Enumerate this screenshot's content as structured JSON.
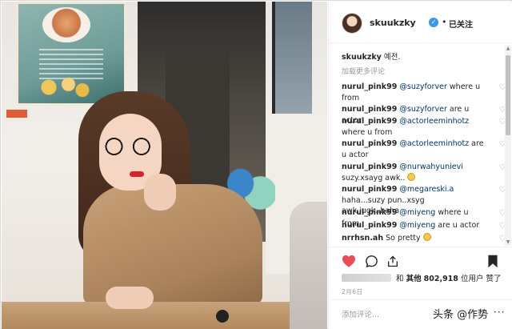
{
  "post": {
    "username": "skuukzky",
    "follow_label": "已关注",
    "separator": "•",
    "verified_mark": "✓",
    "caption_user": "skuukzky",
    "caption_text": "예전.",
    "load_more": "加载更多评论"
  },
  "comments": [
    {
      "user": "nurul_pink99",
      "mention": "@suzyforver",
      "text": " where u from",
      "emoji": false
    },
    {
      "user": "nurul_pink99",
      "mention": "@suzyforver",
      "text": " are u actor",
      "emoji": false
    },
    {
      "user": "nurul_pink99",
      "mention": "@actorleeminhotz",
      "text": " where u from",
      "emoji": false
    },
    {
      "user": "nurul_pink99",
      "mention": "@actorleeminhotz",
      "text": " are u actor",
      "emoji": false
    },
    {
      "user": "nurul_pink99",
      "mention": "@nurwahyunievi",
      "text": " suzy.xsayg awk..",
      "emoji": true
    },
    {
      "user": "nurul_pink99",
      "mention": "@megareski.a",
      "text": " haha...suzy pun..xsyg awk.jugk..haha",
      "emoji": false
    },
    {
      "user": "nurul_pink99",
      "mention": "@miyeng",
      "text": " where u from",
      "emoji": false
    },
    {
      "user": "nurul_pink99",
      "mention": "@miyeng",
      "text": " are u actor",
      "emoji": false
    },
    {
      "user": "nrrhsn.ah",
      "mention": "",
      "text": "So pretty",
      "emoji": true
    }
  ],
  "likes": {
    "and": "和",
    "others_label": "其他",
    "count": "802,918",
    "suffix": "位用户 赞了"
  },
  "date": "2月6日",
  "add_comment": {
    "placeholder": "添加评论..."
  },
  "watermark": "头条 @作势",
  "icons": {
    "like": "heart-filled-icon",
    "comment": "comment-icon",
    "share": "share-icon",
    "save": "bookmark-icon",
    "comment_like": "heart-outline-icon"
  },
  "colors": {
    "like_red": "#ed4956",
    "link": "#003569",
    "muted": "#999999",
    "verified_blue": "#3897f0"
  }
}
